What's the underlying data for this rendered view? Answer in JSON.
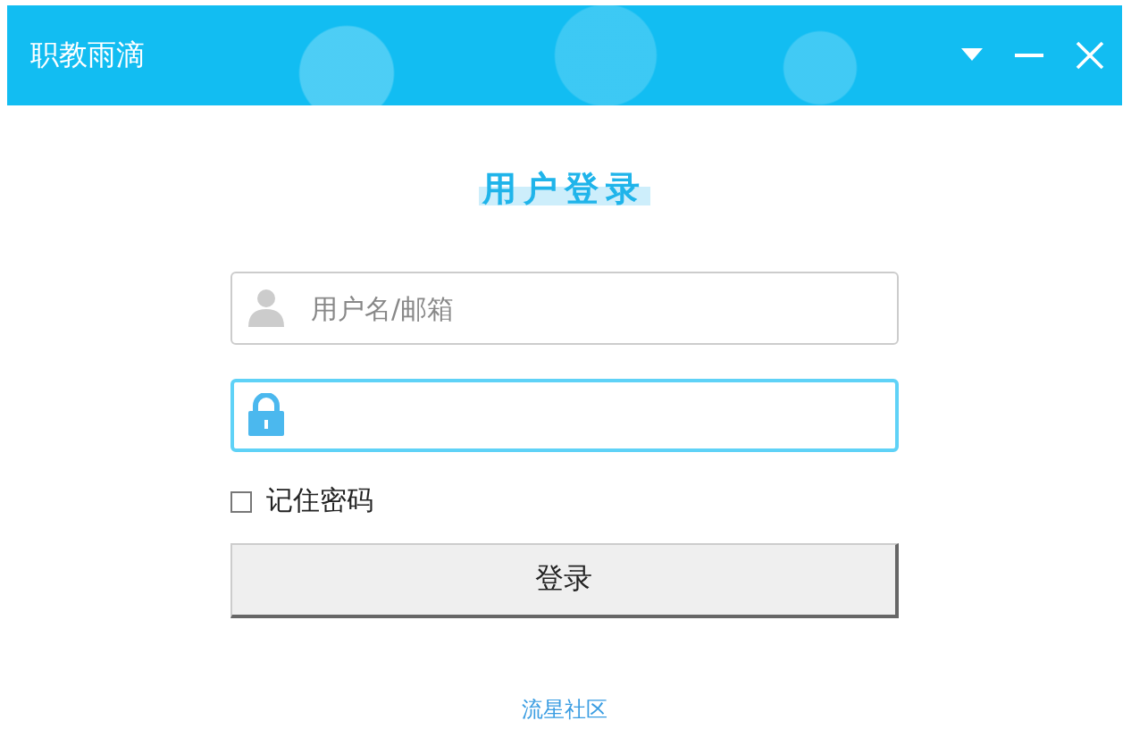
{
  "window": {
    "title": "职教雨滴"
  },
  "heading": "用户登录",
  "username": {
    "placeholder": "用户名/邮箱",
    "focused": false
  },
  "password": {
    "focused": true
  },
  "remember": {
    "label": "记住密码",
    "checked": false
  },
  "login_button": "登录",
  "footer_link": "流星社区"
}
